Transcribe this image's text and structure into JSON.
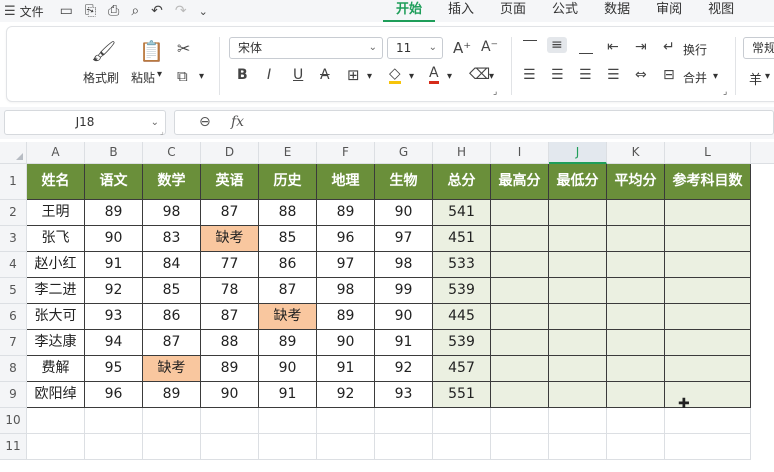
{
  "menubar": {
    "file_label": "文件",
    "tabs": [
      {
        "label": "开始",
        "active": true
      },
      {
        "label": "插入",
        "active": false
      },
      {
        "label": "页面",
        "active": false
      },
      {
        "label": "公式",
        "active": false
      },
      {
        "label": "数据",
        "active": false
      },
      {
        "label": "审阅",
        "active": false
      },
      {
        "label": "视图",
        "active": false
      }
    ]
  },
  "ribbon": {
    "format_painter_label": "格式刷",
    "paste_label": "粘贴",
    "font_name": "宋体",
    "font_size": "11",
    "wrap_label": "换行",
    "merge_label": "合并",
    "general_label": "常规",
    "currency_symbol": "羊"
  },
  "formula_bar": {
    "cell_ref": "J18",
    "fx_label": "fx",
    "content": ""
  },
  "sheet": {
    "columns": [
      "A",
      "B",
      "C",
      "D",
      "E",
      "F",
      "G",
      "H",
      "I",
      "J",
      "K",
      "L"
    ],
    "selected_column": "J",
    "row_numbers": [
      "1",
      "2",
      "3",
      "4",
      "5",
      "6",
      "7",
      "8",
      "9",
      "10",
      "11"
    ],
    "headers": [
      "姓名",
      "语文",
      "数学",
      "英语",
      "历史",
      "地理",
      "生物",
      "总分",
      "最高分",
      "最低分",
      "平均分",
      "参考科目数"
    ],
    "rows": [
      [
        "王明",
        "89",
        "98",
        "87",
        "88",
        "89",
        "90",
        "541",
        "",
        "",
        "",
        ""
      ],
      [
        "张飞",
        "90",
        "83",
        "缺考",
        "85",
        "96",
        "97",
        "451",
        "",
        "",
        "",
        ""
      ],
      [
        "赵小红",
        "91",
        "84",
        "77",
        "86",
        "97",
        "98",
        "533",
        "",
        "",
        "",
        ""
      ],
      [
        "李二进",
        "92",
        "85",
        "78",
        "87",
        "98",
        "99",
        "539",
        "",
        "",
        "",
        ""
      ],
      [
        "张大可",
        "93",
        "86",
        "87",
        "缺考",
        "89",
        "90",
        "445",
        "",
        "",
        "",
        ""
      ],
      [
        "李达康",
        "94",
        "87",
        "88",
        "89",
        "90",
        "91",
        "539",
        "",
        "",
        "",
        ""
      ],
      [
        "费解",
        "95",
        "缺考",
        "89",
        "90",
        "91",
        "92",
        "457",
        "",
        "",
        "",
        ""
      ],
      [
        "欧阳绰",
        "96",
        "89",
        "90",
        "91",
        "92",
        "93",
        "551",
        "",
        "",
        "",
        ""
      ]
    ],
    "absent_text": "缺考"
  },
  "colors": {
    "header_bg": "#6a8f3a",
    "total_bg": "#ebf0e1",
    "absent_bg": "#f9c79f",
    "accent": "#1f9e5a"
  }
}
